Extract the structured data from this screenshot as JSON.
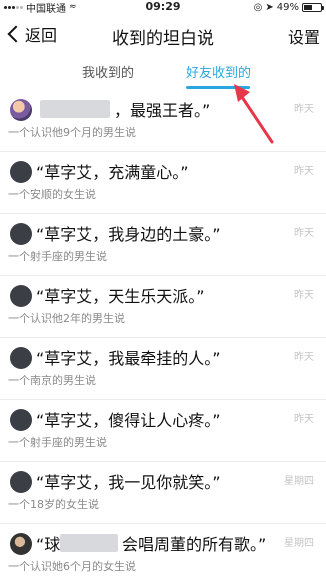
{
  "status_bar": {
    "carrier": "中国联通",
    "time": "09:29",
    "battery": "49%",
    "battery_level": 0.49
  },
  "nav": {
    "back_label": "返回",
    "title": "收到的坦白说",
    "right_label": "设置"
  },
  "tabs": [
    {
      "label": "我收到的",
      "active": false
    },
    {
      "label": "好友收到的",
      "active": true
    }
  ],
  "annotation_color": "#e8374a",
  "accent_color": "#2aa7e0",
  "items": [
    {
      "text": "，最强王者。”",
      "sub": "一个认识他9个月的男生说",
      "time": "昨天",
      "avatar": "colorful-avatar",
      "blurred_name": true
    },
    {
      "text": "“草字艾，充满童心。”",
      "sub": "一个安顺的女生说",
      "time": "昨天",
      "avatar": "dark-avatar",
      "blurred_name": false
    },
    {
      "text": "“草字艾，我身边的土豪。”",
      "sub": "一个射手座的男生说",
      "time": "昨天",
      "avatar": "dark-avatar",
      "blurred_name": false
    },
    {
      "text": "“草字艾，天生乐天派。”",
      "sub": "一个认识他2年的男生说",
      "time": "昨天",
      "avatar": "dark-avatar",
      "blurred_name": false
    },
    {
      "text": "“草字艾，我最牵挂的人。”",
      "sub": "一个南京的男生说",
      "time": "昨天",
      "avatar": "dark-avatar",
      "blurred_name": false
    },
    {
      "text": "“草字艾，傻得让人心疼。”",
      "sub": "一个射手座的男生说",
      "time": "昨天",
      "avatar": "dark-avatar",
      "blurred_name": false
    },
    {
      "text": "“草字艾，我一见你就笑。”",
      "sub": "一个18岁的女生说",
      "time": "星期四",
      "avatar": "dark-avatar",
      "blurred_name": false
    },
    {
      "text": "会唱周董的所有歌。”",
      "sub": "一个认识她6个月的女生说",
      "time": "星期四",
      "avatar": "photo-avatar",
      "blurred_name": true,
      "prefix": "“球"
    }
  ]
}
